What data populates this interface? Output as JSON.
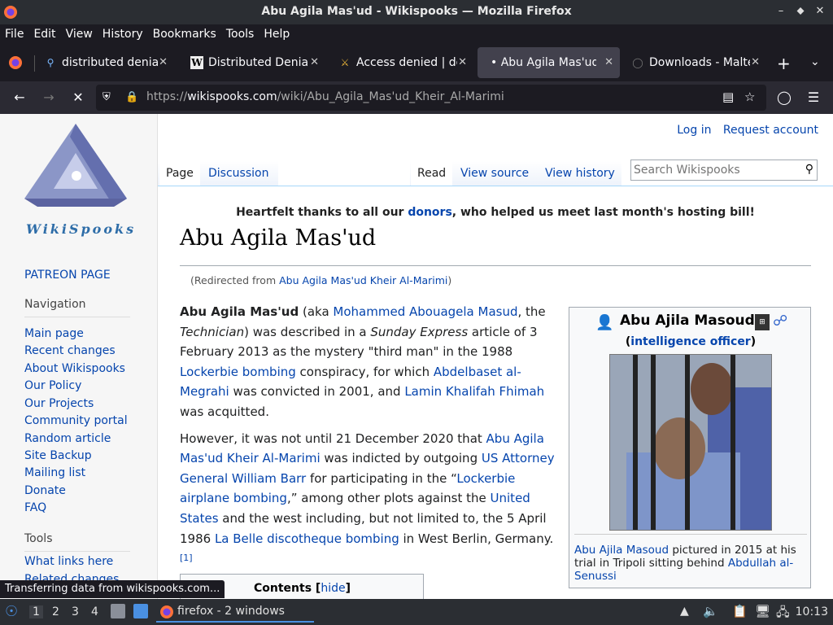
{
  "window": {
    "title": "Abu Agila Mas'ud - Wikispooks — Mozilla Firefox",
    "controls": [
      "–",
      "⬥",
      "✕"
    ]
  },
  "menubar": {
    "items": [
      "File",
      "Edit",
      "View",
      "History",
      "Bookmarks",
      "Tools",
      "Help"
    ]
  },
  "tabs": [
    {
      "label": "distributed denial"
    },
    {
      "label": "Distributed Denial"
    },
    {
      "label": "Access denied | do"
    },
    {
      "label": "• Abu Agila Mas'ud"
    },
    {
      "label": "Downloads - Malte"
    }
  ],
  "navbar": {
    "url_prefix": "https://",
    "url_domain": "wikispooks.com",
    "url_path": "/wiki/Abu_Agila_Mas'ud_Kheir_Al-Marimi"
  },
  "wiki": {
    "logo_text": "WikiSpooks",
    "patreon": "PATREON PAGE",
    "navigation_heading": "Navigation",
    "nav_links": [
      "Main page",
      "Recent changes",
      "About Wikispooks",
      "Our Policy",
      "Our Projects",
      "Community portal",
      "Random article",
      "Site Backup",
      "Mailing list",
      "Donate",
      "FAQ"
    ],
    "tools_heading": "Tools",
    "tools_links": [
      "What links here",
      "Related changes"
    ],
    "top_links": {
      "login": "Log in",
      "request": "Request account"
    },
    "tabs": {
      "page": "Page",
      "discussion": "Discussion",
      "read": "Read",
      "view_source": "View source",
      "view_history": "View history"
    },
    "search_placeholder": "Search Wikispooks",
    "banner_pre": "Heartfelt thanks to all our ",
    "banner_link": "donors",
    "banner_post": ", who helped us meet last month's hosting bill!",
    "page_title": "Abu Agila Mas'ud",
    "redirect_pre": "(Redirected from ",
    "redirect_link": "Abu Agila Mas'ud Kheir Al-Marimi",
    "redirect_post": ")",
    "p1": {
      "bold": "Abu Agila Mas'ud",
      "t1": " (aka ",
      "l1": "Mohammed Abouagela Masud",
      "t2": ", the ",
      "i1": "Technician",
      "t3": ") was described in a ",
      "i2": "Sunday Express",
      "t4": " article of 3 February 2013 as the mystery \"third man\" in the 1988 ",
      "l2": "Lockerbie bombing",
      "t5": " conspiracy, for which ",
      "l3": "Abdelbaset al-Megrahi",
      "t6": " was convicted in 2001, and ",
      "l4": "Lamin Khalifah Fhimah",
      "t7": " was acquitted."
    },
    "p2": {
      "t1": "However, it was not until 21 December 2020 that ",
      "l1": "Abu Agila Mas'ud Kheir Al-Marimi",
      "t2": " was indicted by outgoing ",
      "l2": "US Attorney General",
      "t3": " ",
      "l3": "William Barr",
      "t4": " for participating in the “",
      "l4": "Lockerbie airplane bombing",
      "t5": ",” among other plots against the ",
      "l5": "United States",
      "t6": " and the west including, but not limited to, the 5 April 1986 ",
      "l6": "La Belle discotheque bombing",
      "t7": " in West Berlin, Germany.",
      "ref": "[1]"
    },
    "infobox": {
      "name": "Abu Ajila Masoud",
      "role_pre": "(",
      "role": "intelligence officer",
      "role_post": ")",
      "cap_link1": "Abu Ajila Masoud",
      "cap_text": " pictured in 2015 at his trial in Tripoli sitting behind ",
      "cap_link2": "Abdullah al-Senussi"
    },
    "toc": {
      "title": "Contents",
      "pre": " [",
      "toggle": "hide",
      "post": "]"
    }
  },
  "status": "Transferring data from wikispooks.com...",
  "taskbar": {
    "workspaces": [
      "1",
      "2",
      "3",
      "4"
    ],
    "app_label": "firefox - 2 windows",
    "clock": "10:13"
  }
}
